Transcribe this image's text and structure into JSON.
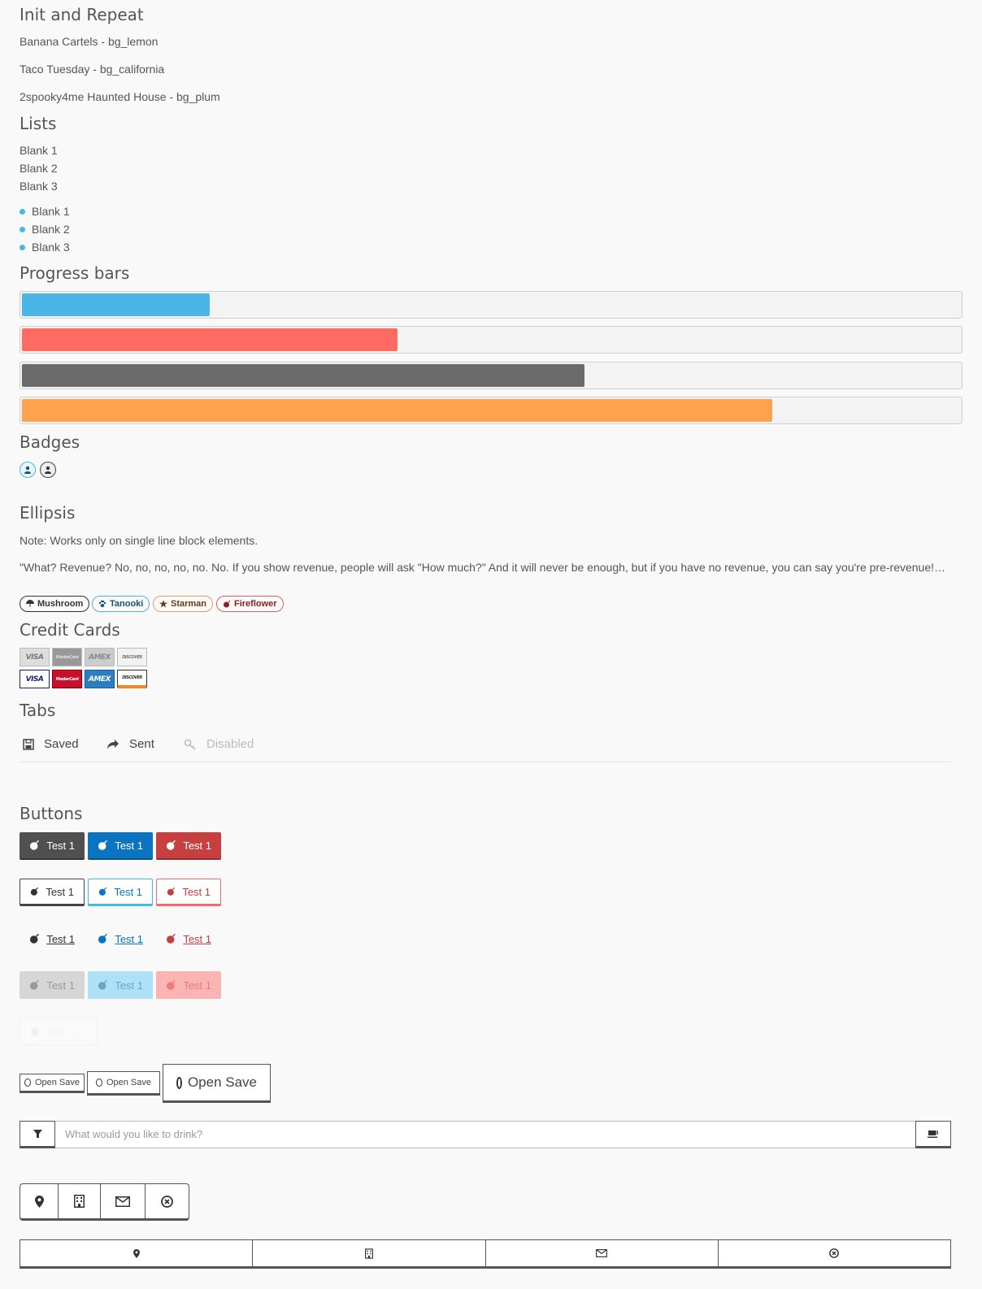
{
  "sections": {
    "init_repeat": "Init and Repeat",
    "lists": "Lists",
    "progress": "Progress bars",
    "badges": "Badges",
    "ellipsis": "Ellipsis",
    "credit_cards": "Credit Cards",
    "tabs": "Tabs",
    "buttons": "Buttons"
  },
  "init_items": [
    "Banana Cartels - bg_lemon",
    "Taco Tuesday - bg_california",
    "2spooky4me Haunted House - bg_plum"
  ],
  "plain_list": [
    "Blank 1",
    "Blank 2",
    "Blank 3"
  ],
  "bullet_list": [
    "Blank 1",
    "Blank 2",
    "Blank 3"
  ],
  "progress": [
    {
      "value": 20,
      "color": "#4ab6e8"
    },
    {
      "value": 40,
      "color": "#ff6a62"
    },
    {
      "value": 60,
      "color": "#6b6b6b"
    },
    {
      "value": 80,
      "color": "#ffa24c"
    }
  ],
  "ellipsis": {
    "note": "Note: Works only on single line block elements.",
    "quote": "\"What? Revenue? No, no, no, no, no. No. If you show revenue, people will ask \"How much?\" And it will never be enough, but if you have no revenue, you can say you're pre-revenue! You're a potential pure play... It's not about how much you earn, it's about how much you're worth.\""
  },
  "pills": [
    {
      "label": "Mushroom",
      "color": "#333",
      "icon": "umbrella-icon"
    },
    {
      "label": "Tanooki",
      "color": "#1f78b4",
      "icon": "paw-icon"
    },
    {
      "label": "Starman",
      "color": "#e07a1a",
      "icon": "star-icon"
    },
    {
      "label": "Fireflower",
      "color": "#c0392b",
      "icon": "bomb-icon"
    }
  ],
  "cards": [
    {
      "label": "VISA"
    },
    {
      "label": "MasterCard"
    },
    {
      "label": "AMEX"
    },
    {
      "label": "DISCOVER"
    }
  ],
  "tabs": [
    {
      "label": "Saved",
      "icon": "floppy-icon"
    },
    {
      "label": "Sent",
      "icon": "share-icon"
    },
    {
      "label": "Disabled",
      "icon": "key-icon"
    }
  ],
  "button_label": "Test 1",
  "open_save": "Open Save",
  "drink_placeholder": "What would you like to drink?",
  "colors": {
    "dark": "#505050",
    "blue": "#0a74c0",
    "red": "#c74040",
    "lightblue": "#4ab6e8",
    "lightred": "#f46b6b"
  }
}
